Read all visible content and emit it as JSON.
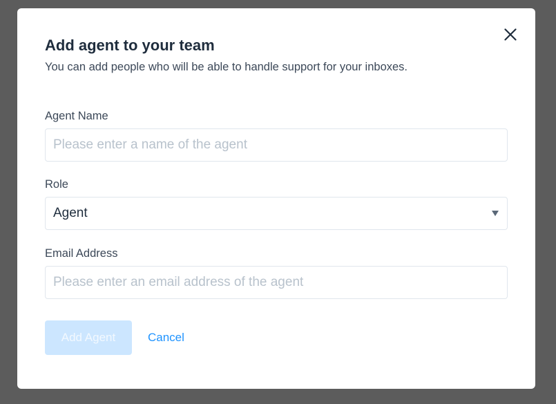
{
  "modal": {
    "title": "Add agent to your team",
    "subtitle": "You can add people who will be able to handle support for your inboxes."
  },
  "fields": {
    "agent_name": {
      "label": "Agent Name",
      "value": "",
      "placeholder": "Please enter a name of the agent"
    },
    "role": {
      "label": "Role",
      "selected": "Agent"
    },
    "email": {
      "label": "Email Address",
      "value": "",
      "placeholder": "Please enter an email address of the agent"
    }
  },
  "actions": {
    "submit_label": "Add Agent",
    "cancel_label": "Cancel"
  },
  "icons": {
    "close": "close-icon",
    "dropdown": "chevron-down-icon"
  },
  "colors": {
    "overlay": "#5c5c5c",
    "title": "#1f2d3d",
    "text": "#3c4858",
    "border": "#e0e6ed",
    "placeholder": "#b8c2cc",
    "primary_disabled": "#cce6ff",
    "link": "#1f93ff"
  }
}
